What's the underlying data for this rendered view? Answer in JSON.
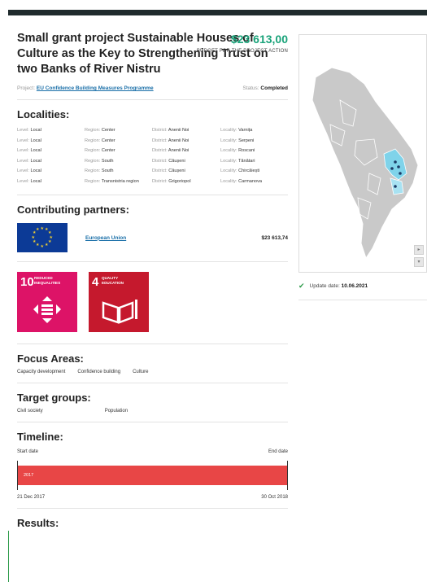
{
  "project": {
    "title": "Small grant project Sustainable Houses of Culture as the Key to Strengthening Trust on two Banks of River Nistru",
    "amount": "$23 613,00",
    "amount_label": "BUDGET FOR THE PROJECT ACTION",
    "project_label": "Project:",
    "project_link": "EU Confidence Building Measures Programme",
    "status_label": "Status:",
    "status_value": "Completed"
  },
  "localities": {
    "title": "Localities:",
    "columns": {
      "level": "Level:",
      "region": "Region:",
      "district": "District:",
      "locality": "Locality:"
    },
    "rows": [
      {
        "level": "Local",
        "region": "Center",
        "district": "Anenii Noi",
        "locality": "Varnița"
      },
      {
        "level": "Local",
        "region": "Center",
        "district": "Anenii Noi",
        "locality": "Serpeni"
      },
      {
        "level": "Local",
        "region": "Center",
        "district": "Anenii Noi",
        "locality": "Roscani"
      },
      {
        "level": "Local",
        "region": "South",
        "district": "Căușeni",
        "locality": "Tănătari"
      },
      {
        "level": "Local",
        "region": "South",
        "district": "Căușeni",
        "locality": "Chircăiești"
      },
      {
        "level": "Local",
        "region": "Transnistria region",
        "district": "Grigoriopol",
        "locality": "Carmanova"
      }
    ]
  },
  "partners": {
    "title": "Contributing partners:",
    "items": [
      {
        "name": "European Union",
        "amount": "$23 613,74"
      }
    ]
  },
  "sdgs": [
    {
      "number": "10",
      "text": "REDUCED INEQUALITIES",
      "color": "#dd1367"
    },
    {
      "number": "4",
      "text": "QUALITY EDUCATION",
      "color": "#c5192d"
    }
  ],
  "focus": {
    "title": "Focus Areas:",
    "items": [
      "Capacity development",
      "Confidence building",
      "Culture"
    ]
  },
  "targets": {
    "title": "Target groups:",
    "items": [
      "Civil society",
      "Population"
    ]
  },
  "timeline": {
    "title": "Timeline:",
    "start_label": "Start date",
    "end_label": "End date",
    "year": "2017",
    "start_date": "21 Dec 2017",
    "end_date": "30 Oct 2018",
    "bar_color": "#e84646"
  },
  "results": {
    "title": "Results:"
  },
  "sidebar": {
    "update_label": "Update date:",
    "update_value": "10.06.2021"
  },
  "icons": {
    "check": "check-icon",
    "map_next": "arrow-right-icon",
    "map_prev": "arrow-down-icon"
  }
}
